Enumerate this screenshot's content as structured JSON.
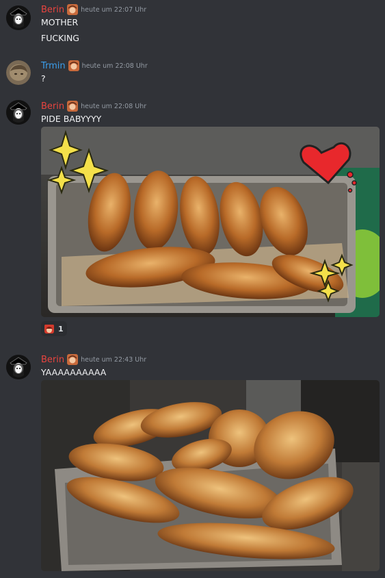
{
  "messages": [
    {
      "author": "Berin",
      "timestamp": "heute um 22:07 Uhr",
      "lines": [
        "MOTHER",
        "FUCKING"
      ]
    },
    {
      "author": "Trmin",
      "timestamp": "heute um 22:08 Uhr",
      "lines": [
        "?"
      ]
    },
    {
      "author": "Berin",
      "timestamp": "heute um 22:08 Uhr",
      "lines": [
        "PIDE BABYYYY"
      ],
      "reaction": {
        "count": "1"
      }
    },
    {
      "author": "Berin",
      "timestamp": "heute um 22:43 Uhr",
      "lines": [
        "YAAAAAAAAAA"
      ]
    }
  ],
  "colors": {
    "background": "#313338",
    "berin_name": "#e8443f",
    "trmin_name": "#3b9dea",
    "timestamp": "#949ba4",
    "text": "#f2f3f5"
  },
  "icons": [
    "avatar-berin",
    "avatar-trmin",
    "role-badge-icon",
    "reaction-emoji-icon",
    "heart-sticker",
    "sparkle-sticker"
  ]
}
